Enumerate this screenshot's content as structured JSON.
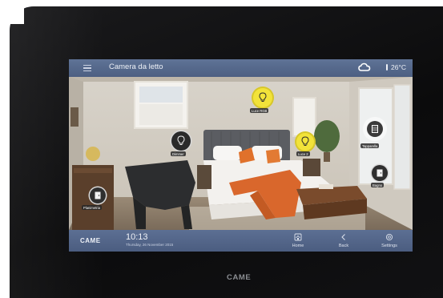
{
  "header": {
    "room_title": "Camera da letto",
    "temperature": "26°C"
  },
  "hotspots": [
    {
      "id": "luce-rgb",
      "label": "Luce RGB",
      "state": "on"
    },
    {
      "id": "dimmer",
      "label": "Dimmer",
      "state": "off"
    },
    {
      "id": "luce-2",
      "label": "Luce 2",
      "state": "on"
    },
    {
      "id": "tapparella",
      "label": "Tapparella",
      "state": "off"
    },
    {
      "id": "bagno",
      "label": "Bagno",
      "state": "off"
    },
    {
      "id": "planimetria",
      "label": "Planimetria",
      "state": "off"
    }
  ],
  "footer": {
    "brand": "CAME",
    "time": "10:13",
    "date": "Thursday, 26 November 2015",
    "nav": [
      {
        "label": "Home",
        "icon": "home-icon"
      },
      {
        "label": "Back",
        "icon": "back-icon"
      },
      {
        "label": "Settings",
        "icon": "settings-icon"
      }
    ]
  },
  "device": {
    "logo": "CAME"
  },
  "colors": {
    "bar": "#566a8e",
    "light_on": "#f2e33a",
    "light_off": "#2a2a2a"
  }
}
